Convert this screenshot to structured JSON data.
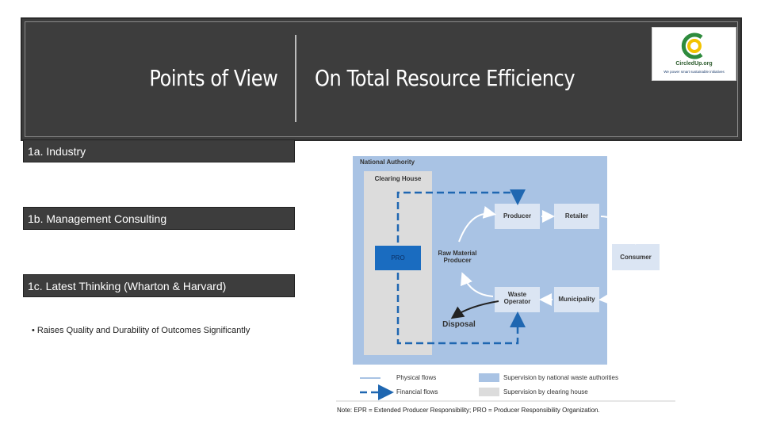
{
  "header": {
    "title_left": "Points of View",
    "title_right": "On Total Resource Efficiency"
  },
  "logo": {
    "name": "CircledUp.org",
    "tagline": "We power smart sustainable initiatives"
  },
  "items": [
    {
      "label": "1a. Industry"
    },
    {
      "label": "1b. Management Consulting"
    },
    {
      "label": "1c. Latest Thinking (Wharton & Harvard)"
    }
  ],
  "bullet": "Raises Quality and Durability of Outcomes Significantly",
  "diagram": {
    "national_authority": "National Authority",
    "clearing_house": "Clearing House",
    "pro": "PRO",
    "raw_material_producer": "Raw Material Producer",
    "producer": "Producer",
    "retailer": "Retailer",
    "consumer": "Consumer",
    "waste_operator": "Waste Operator",
    "municipality": "Municipality",
    "disposal": "Disposal",
    "legend": {
      "physical_flows": "Physical flows",
      "financial_flows": "Financial flows",
      "supervision_national": "Supervision by national waste authorities",
      "supervision_clearing": "Supervision by clearing house"
    },
    "note": "Note: EPR = Extended Producer Responsibility; PRO = Producer Responsibility Organization.",
    "colors": {
      "national_bg": "#a9c3e4",
      "clearing_bg": "#dcdcdc",
      "node_bg": "#dbe5f3",
      "pro_bg": "#1a6cc0",
      "flow_dash": "#1f67b1",
      "physical_arrow": "#ffffff"
    }
  }
}
